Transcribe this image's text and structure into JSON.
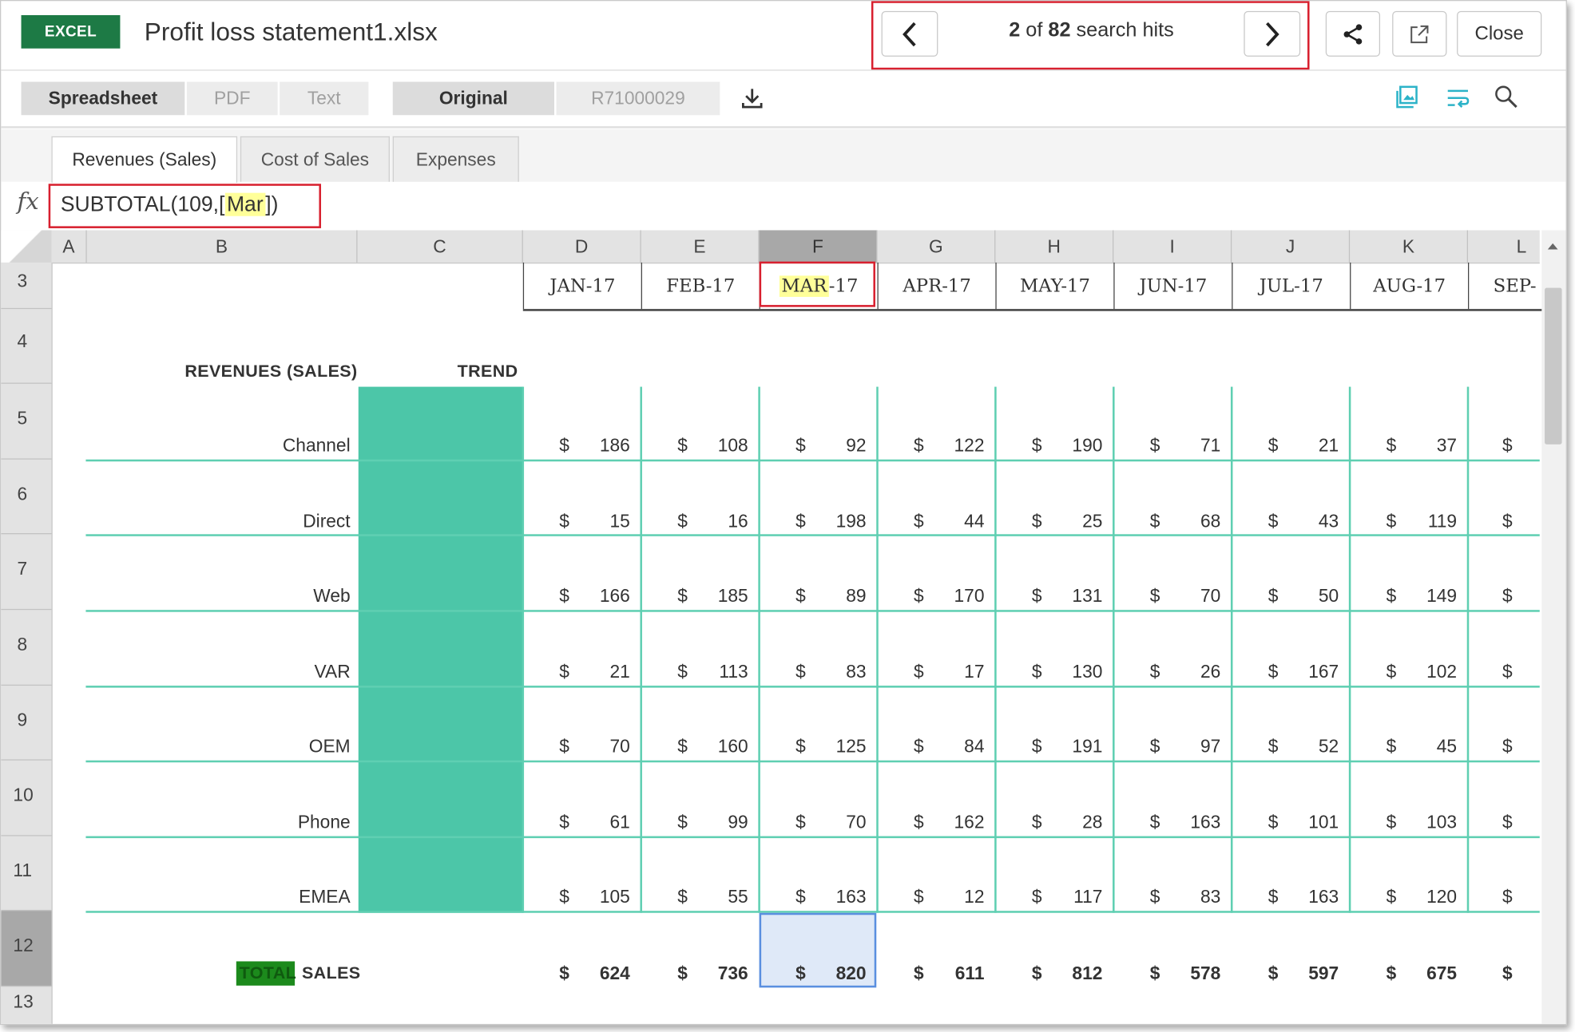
{
  "app": {
    "badge": "EXCEL",
    "file_title": "Profit loss statement1.xlsx"
  },
  "search": {
    "hits_current": "2",
    "hits_of": " of ",
    "hits_total": "82",
    "hits_suffix": " search hits"
  },
  "toolbar": {
    "close_label": "Close"
  },
  "view_modes": [
    "Spreadsheet",
    "PDF",
    "Text"
  ],
  "version_modes": [
    "Original",
    "R71000029"
  ],
  "sheet_tabs": [
    "Revenues (Sales)",
    "Cost of Sales",
    "Expenses"
  ],
  "formula": {
    "prefix": "SUBTOTAL(109,[",
    "highlight": "Mar",
    "suffix": "])"
  },
  "columns": [
    "A",
    "B",
    "C",
    "D",
    "E",
    "F",
    "G",
    "H",
    "I",
    "J",
    "K",
    "L"
  ],
  "rows": [
    "3",
    "4",
    "5",
    "6",
    "7",
    "8",
    "9",
    "10",
    "11",
    "12",
    "13"
  ],
  "months": [
    "JAN-17",
    "FEB-17",
    "MAR-17",
    "APR-17",
    "MAY-17",
    "JUN-17",
    "JUL-17",
    "AUG-17",
    "SEP-"
  ],
  "section": {
    "label": "REVENUES (SALES)",
    "trend_label": "TREND"
  },
  "revenue_rows": [
    {
      "label": "Channel",
      "values": [
        "186",
        "108",
        "92",
        "122",
        "190",
        "71",
        "21",
        "37"
      ]
    },
    {
      "label": "Direct",
      "values": [
        "15",
        "16",
        "198",
        "44",
        "25",
        "68",
        "43",
        "119"
      ]
    },
    {
      "label": "Web",
      "values": [
        "166",
        "185",
        "89",
        "170",
        "131",
        "70",
        "50",
        "149"
      ]
    },
    {
      "label": "VAR",
      "values": [
        "21",
        "113",
        "83",
        "17",
        "130",
        "26",
        "167",
        "102"
      ]
    },
    {
      "label": "OEM",
      "values": [
        "70",
        "160",
        "125",
        "84",
        "191",
        "97",
        "52",
        "45"
      ]
    },
    {
      "label": "Phone",
      "values": [
        "61",
        "99",
        "70",
        "162",
        "28",
        "163",
        "101",
        "103"
      ]
    },
    {
      "label": "EMEA",
      "values": [
        "105",
        "55",
        "163",
        "12",
        "117",
        "83",
        "163",
        "120"
      ]
    }
  ],
  "total_row": {
    "label_tag": "TOTAL",
    "label": "SALES",
    "values": [
      "624",
      "736",
      "820",
      "611",
      "812",
      "578",
      "597",
      "675"
    ]
  },
  "currency": "$",
  "colors": {
    "excel_green": "#1d7a45",
    "trend_fill": "#4cc6a8",
    "highlight_red": "#d8202f",
    "search_yellow": "#ffff99",
    "selection_blue": "#5a8fe0"
  }
}
